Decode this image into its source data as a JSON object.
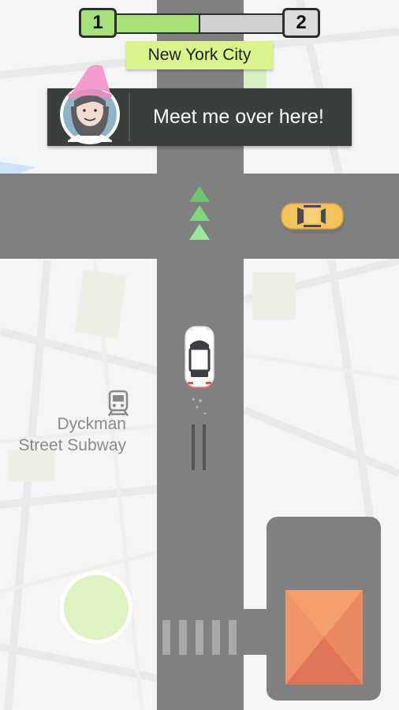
{
  "hud": {
    "current_level": "1",
    "next_level": "2",
    "progress": 0.5,
    "city_name": "New York City"
  },
  "dialog": {
    "message": "Meet me over here!"
  },
  "map": {
    "poi_label_line1": "Dyckman",
    "poi_label_line2": "Street Subway"
  },
  "colors": {
    "road": "#808080",
    "progress_fill": "#a6e27a",
    "city_label_bg": "#d9f48c",
    "dialog_bg": "#3b3e3e",
    "arrow": "#7ed87e",
    "taxi": "#f2c25c",
    "pickup_circle": "#def3c2",
    "building_roof": "#ef8c5f"
  }
}
